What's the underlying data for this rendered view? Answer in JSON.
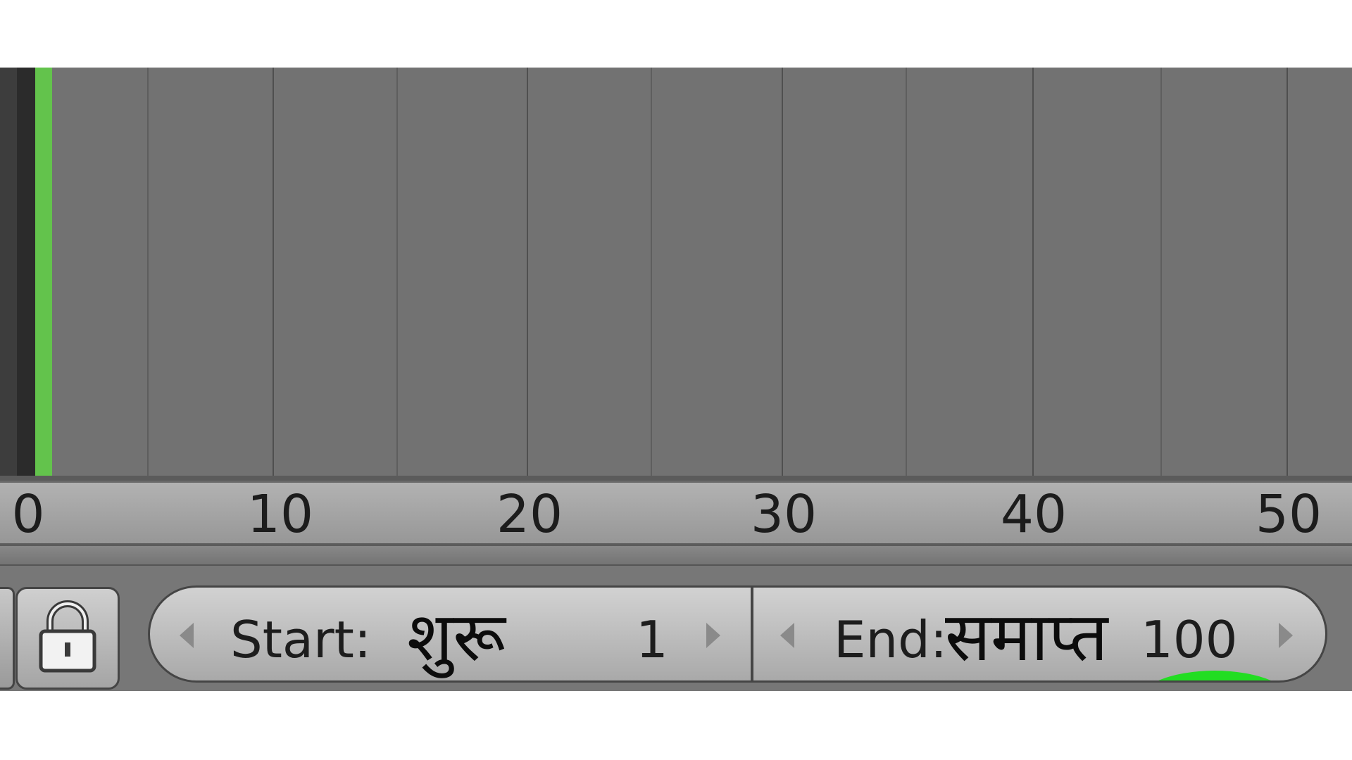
{
  "timeline": {
    "ruler_ticks": [
      "0",
      "10",
      "20",
      "30",
      "40",
      "50"
    ],
    "playhead_frame": 1,
    "playhead_color": "#63c34c"
  },
  "controls": {
    "lock_icon": "lock-icon",
    "start": {
      "label": "Start:",
      "overlay_text": "शुरू",
      "value": "1"
    },
    "end": {
      "label": "End:",
      "overlay_text": "समाप्त",
      "value": "100"
    },
    "highlight_color": "#22dd22"
  }
}
